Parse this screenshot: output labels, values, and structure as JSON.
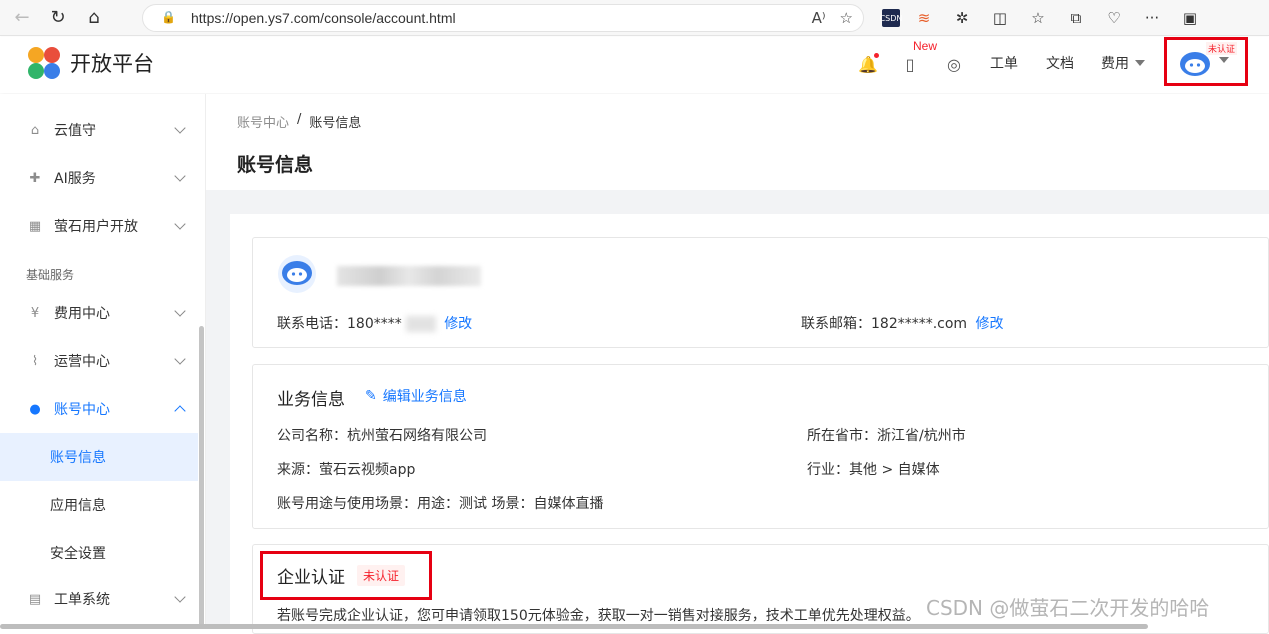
{
  "browser": {
    "url": "https://open.ys7.com/console/account.html",
    "lock_icon": "lock-icon"
  },
  "header": {
    "logo_text": "开放平台",
    "new_label": "New",
    "nav": [
      "工单",
      "文档",
      "费用"
    ],
    "unverified_tag": "未认证"
  },
  "sidebar": {
    "items": [
      {
        "label": "云值守",
        "icon": "cloud-guard-icon"
      },
      {
        "label": "AI服务",
        "icon": "ai-icon"
      },
      {
        "label": "萤石用户开放",
        "icon": "grid-icon"
      }
    ],
    "group_label": "基础服务",
    "items2": [
      {
        "label": "费用中心",
        "icon": "yen-icon"
      },
      {
        "label": "运营中心",
        "icon": "chart-icon"
      },
      {
        "label": "账号中心",
        "icon": "user-icon"
      }
    ],
    "sub_items": [
      "账号信息",
      "应用信息",
      "安全设置"
    ],
    "last_item": {
      "label": "工单系统",
      "icon": "ticket-icon"
    }
  },
  "main": {
    "breadcrumb": [
      "账号中心",
      "/",
      "账号信息"
    ],
    "page_title": "账号信息",
    "profile": {
      "phone_label": "联系电话：180****",
      "phone_edit": "修改",
      "email_label": "联系邮箱：182*****.com",
      "email_edit": "修改"
    },
    "business": {
      "title": "业务信息",
      "edit_link": "编辑业务信息",
      "company": "公司名称：杭州萤石网络有限公司",
      "region": "所在省市：浙江省/杭州市",
      "source": "来源：萤石云视频app",
      "industry": "行业：其他 > 自媒体",
      "usage": "账号用途与使用场景：用途：测试 场景：自媒体直播"
    },
    "enterprise": {
      "title": "企业认证",
      "badge": "未认证",
      "desc": "若账号完成企业认证，您可申请领取150元体验金，获取一对一销售对接服务，技术工单优先处理权益。"
    }
  },
  "watermark": "CSDN @做萤石二次开发的哈哈"
}
